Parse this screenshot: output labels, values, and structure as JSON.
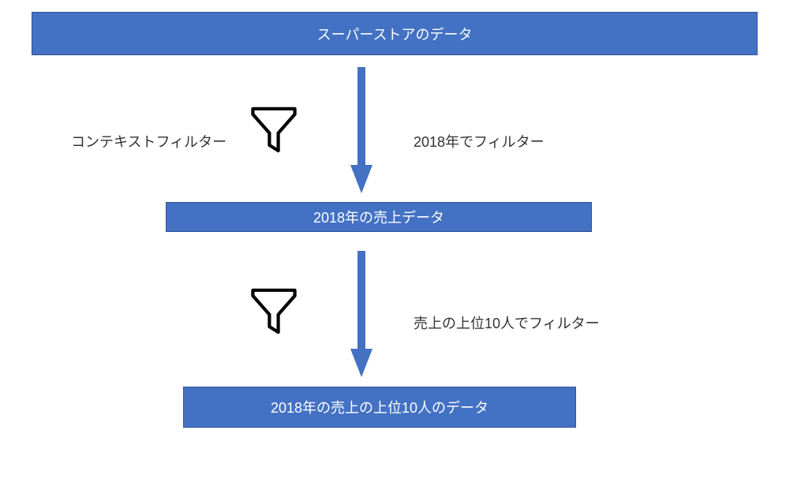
{
  "boxes": {
    "top": "スーパーストアのデータ",
    "middle": "2018年の売上データ",
    "bottom": "2018年の売上の上位10人のデータ"
  },
  "labels": {
    "contextFilter": "コンテキストフィルター",
    "filter2018": "2018年でフィルター",
    "filterTop10": "売上の上位10人でフィルター"
  },
  "colors": {
    "boxFill": "#4371c4",
    "boxBorder": "#2f5597",
    "text": "#333"
  }
}
